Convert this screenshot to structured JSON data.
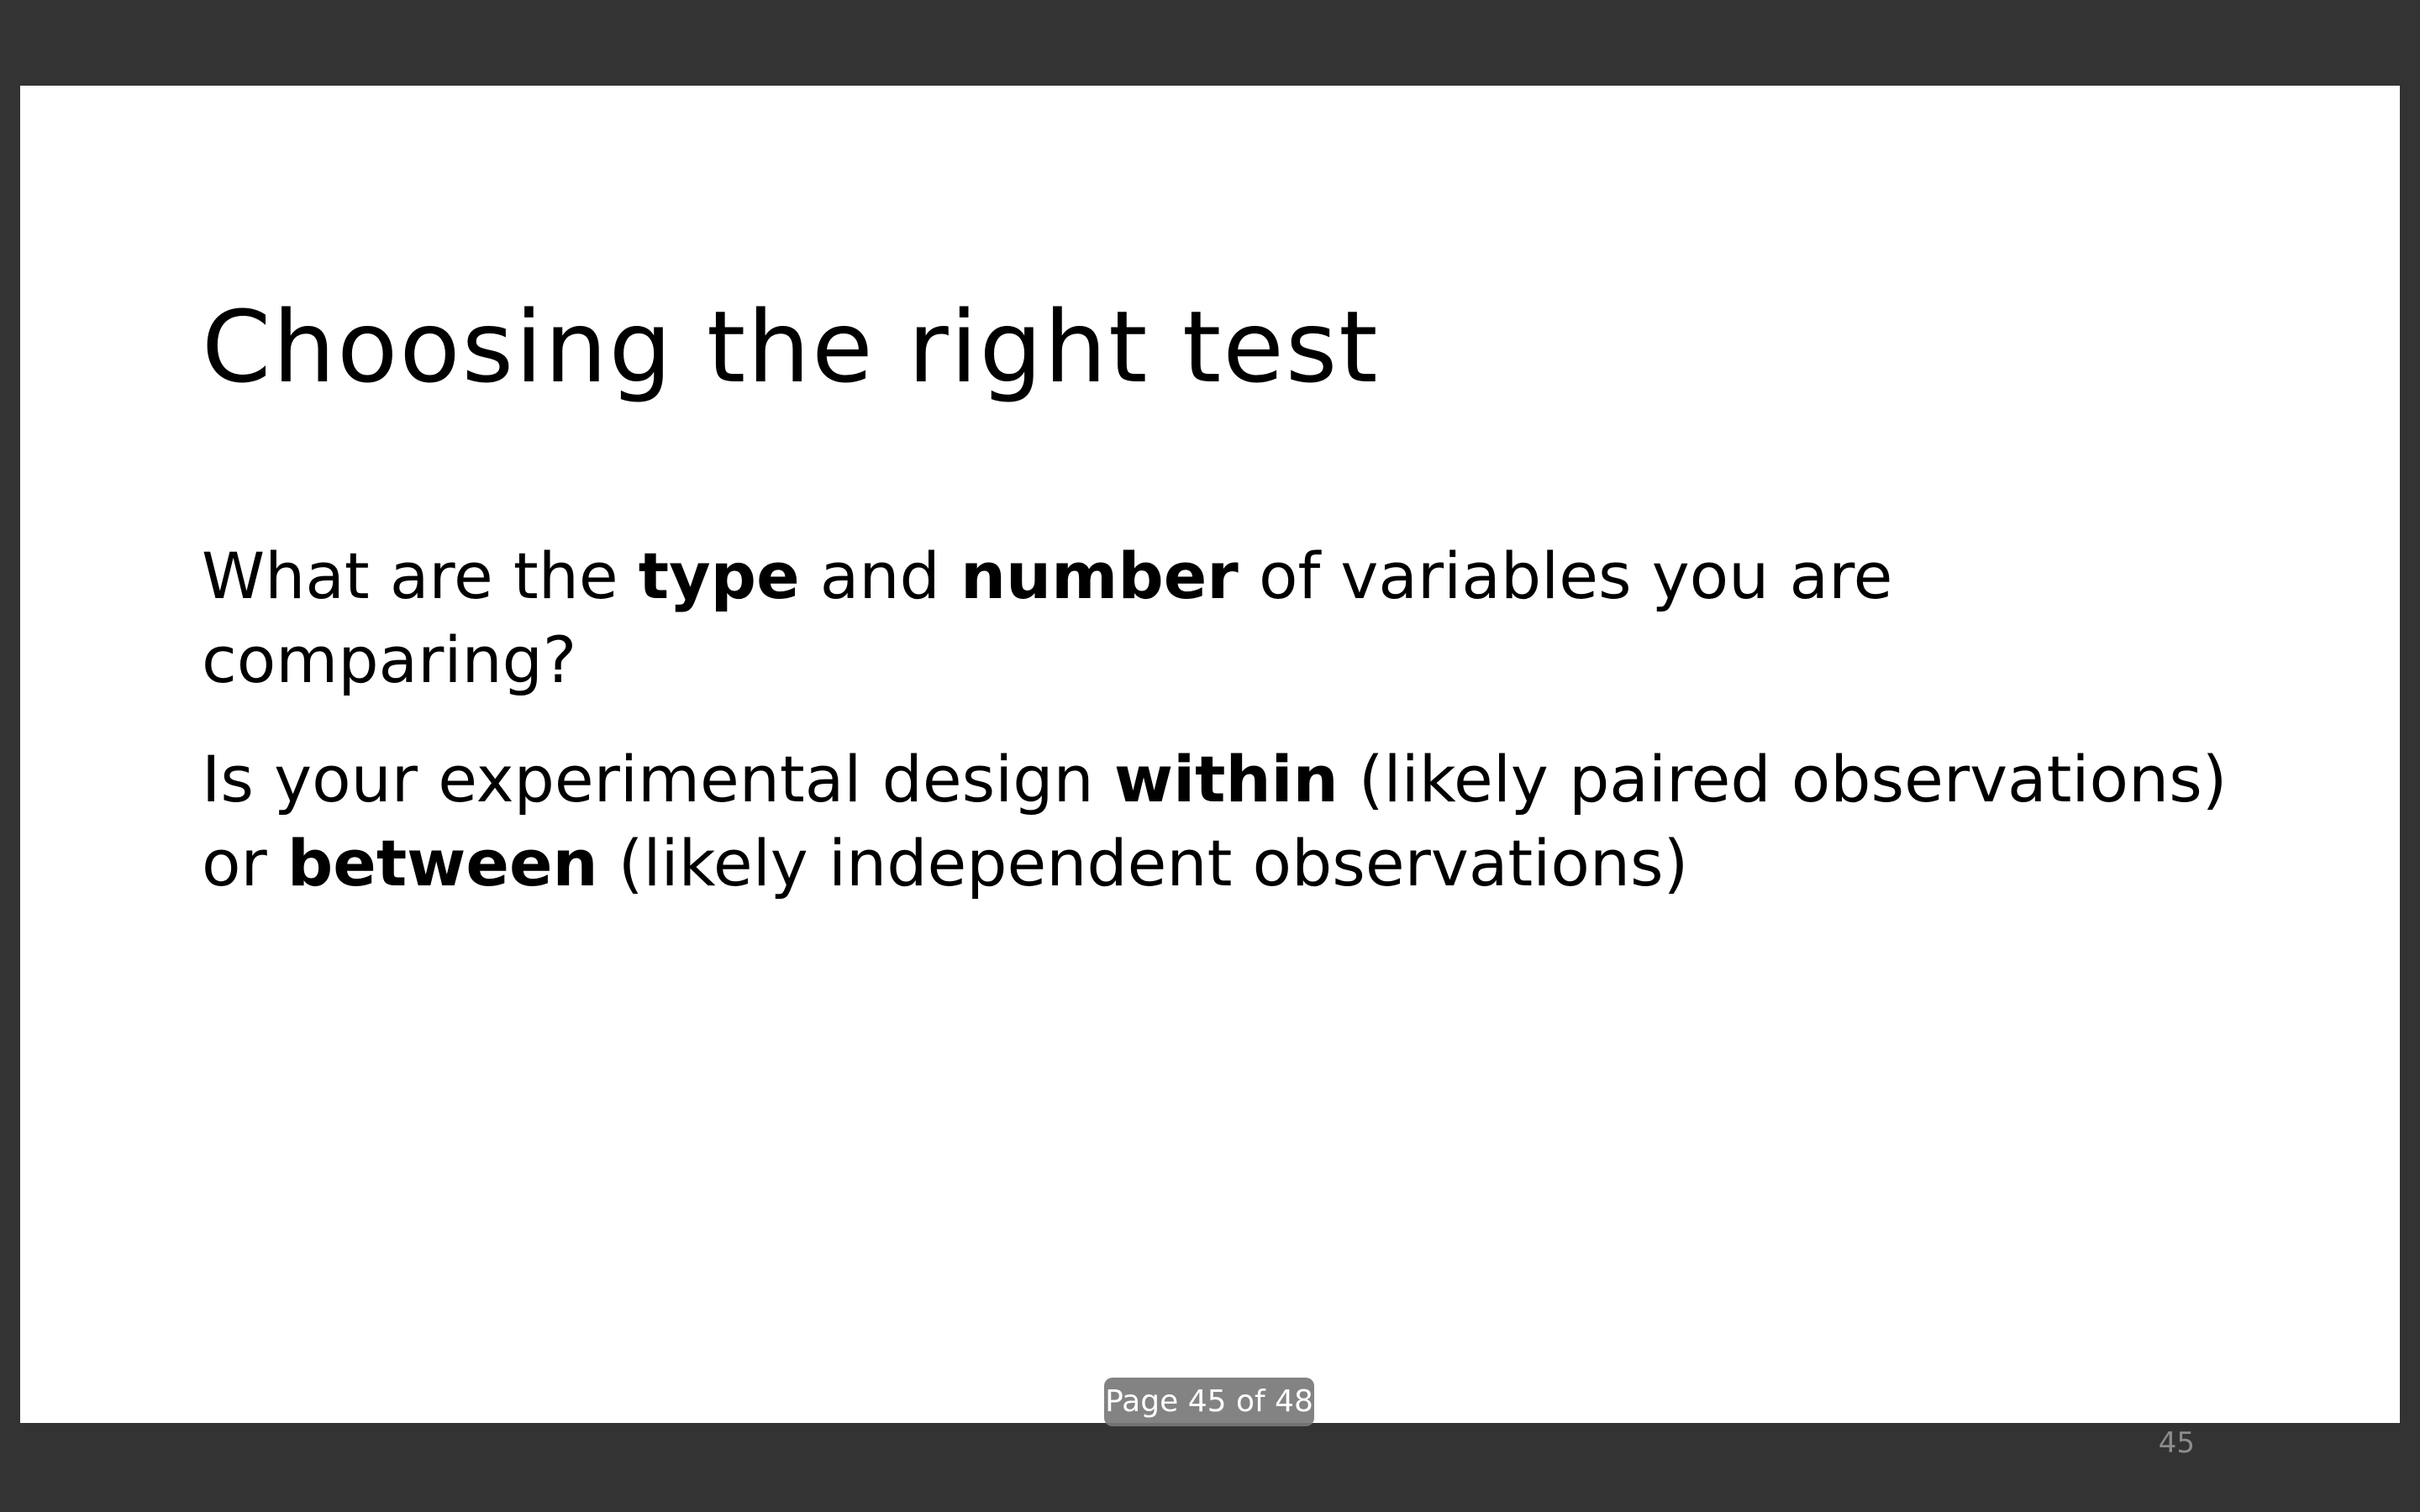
{
  "slide": {
    "title": "Choosing the right test",
    "paragraph1": {
      "part1": "What are the ",
      "bold1": "type",
      "part2": " and ",
      "bold2": "number",
      "part3": " of variables you are comparing?"
    },
    "paragraph2": {
      "part1": "Is your experimental design ",
      "bold1": "within",
      "part2": " (likely paired observations) or ",
      "bold2": "between",
      "part3": " (likely independent observations)"
    },
    "slide_number": "45"
  },
  "viewer": {
    "page_indicator": "Page 45 of 48"
  }
}
